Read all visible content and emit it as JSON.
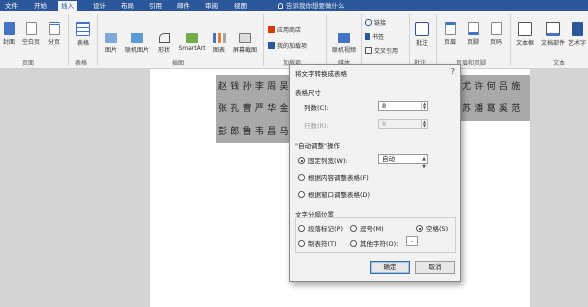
{
  "tabs": [
    "文件",
    "开始",
    "插入",
    "设计",
    "布局",
    "引用",
    "邮件",
    "审阅",
    "视图"
  ],
  "active_tab": "插入",
  "tell_me": "告诉我你想要做什么",
  "ribbon": {
    "pages": [
      "封面",
      "空白页",
      "分页"
    ],
    "pages_group": "页面",
    "table": "表格",
    "table_group": "表格",
    "illustrations": [
      "图片",
      "联机图片",
      "形状",
      "SmartArt",
      "图表",
      "屏幕截图"
    ],
    "illustrations_group": "插图",
    "addins": [
      "应用商店",
      "我的加载项"
    ],
    "addins_group": "加载项",
    "media": "联机视频",
    "media_group": "媒体",
    "links": [
      "链接",
      "书签",
      "交叉引用"
    ],
    "links_group": "链接",
    "comment": "批注",
    "comment_group": "批注",
    "header_footer": [
      "页眉",
      "页脚",
      "页码"
    ],
    "header_footer_group": "页眉和页脚",
    "text": [
      "文本框",
      "文档部件",
      "艺术字"
    ],
    "text_group": "文本"
  },
  "document": {
    "line1": "赵钱孙李周吴",
    "line1_right": "尤许何吕施",
    "line2": "张孔曹严华金",
    "line2_right": "苏潘葛奚范",
    "line3": "彭郎鲁韦昌马"
  },
  "dialog": {
    "title": "将文字转换成表格",
    "close": "?",
    "table_size": "表格尺寸",
    "columns_label": "列数(C):",
    "columns_value": "8",
    "rows_label": "行数(R):",
    "rows_value": "8",
    "autofit_section": "\"自动调整\"操作",
    "fixed_width": "固定列宽(W):",
    "fixed_width_value": "自动",
    "autofit_contents": "根据内容调整表格(F)",
    "autofit_window": "根据窗口调整表格(D)",
    "separator_section": "文字分隔位置",
    "paragraph_mark": "段落标记(P)",
    "comma": "逗号(M)",
    "space": "空格(S)",
    "tab": "制表符(T)",
    "other": "其他字符(O):",
    "other_value": "-",
    "ok": "确定",
    "cancel": "取消"
  },
  "colors": {
    "accent": "#2b579a",
    "highlight": "#a9a9a9"
  }
}
